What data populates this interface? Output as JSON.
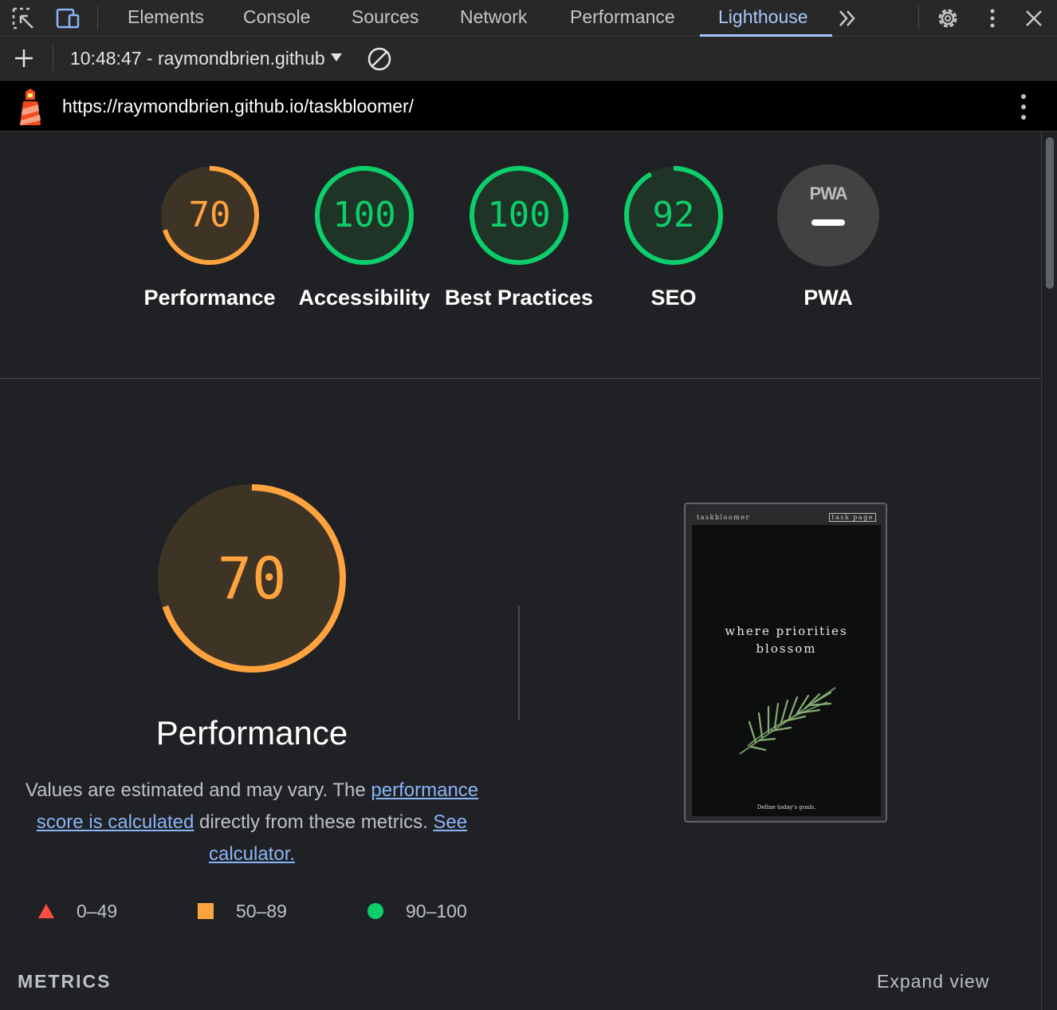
{
  "tabs": [
    {
      "label": "Elements",
      "active": false
    },
    {
      "label": "Console",
      "active": false
    },
    {
      "label": "Sources",
      "active": false
    },
    {
      "label": "Network",
      "active": false
    },
    {
      "label": "Performance",
      "active": false
    },
    {
      "label": "Lighthouse",
      "active": true
    }
  ],
  "toolbar": {
    "report_selector": "10:48:47 - raymondbrien.github.io"
  },
  "url": "https://raymondbrien.github.io/taskbloomer/",
  "scores": [
    {
      "label": "Performance",
      "value": "70",
      "score": 70,
      "color": "#ffa33f"
    },
    {
      "label": "Accessibility",
      "value": "100",
      "score": 100,
      "color": "#0cce6b"
    },
    {
      "label": "Best Practices",
      "value": "100",
      "score": 100,
      "color": "#0cce6b"
    },
    {
      "label": "SEO",
      "value": "92",
      "score": 92,
      "color": "#0cce6b"
    },
    {
      "label": "PWA",
      "value": "PWA",
      "score": null,
      "color": "#9aa0a6"
    }
  ],
  "performance": {
    "title": "Performance",
    "score": 70,
    "value": "70",
    "desc_prefix": "Values are estimated and may vary. The ",
    "link_score": "performance score is calculated",
    "desc_middle": " directly from these metrics. ",
    "link_calc": "See calculator."
  },
  "legend": [
    {
      "label": "0–49",
      "color": "#ff4e42"
    },
    {
      "label": "50–89",
      "color": "#ffa33f"
    },
    {
      "label": "90–100",
      "color": "#0cce6b"
    }
  ],
  "metrics": {
    "title": "METRICS",
    "expand": "Expand view"
  },
  "screenshot": {
    "brand": "taskbloomer",
    "button": "task page",
    "tagline_1": "where priorities",
    "tagline_2": "blossom",
    "footer": "Define today's goals."
  }
}
